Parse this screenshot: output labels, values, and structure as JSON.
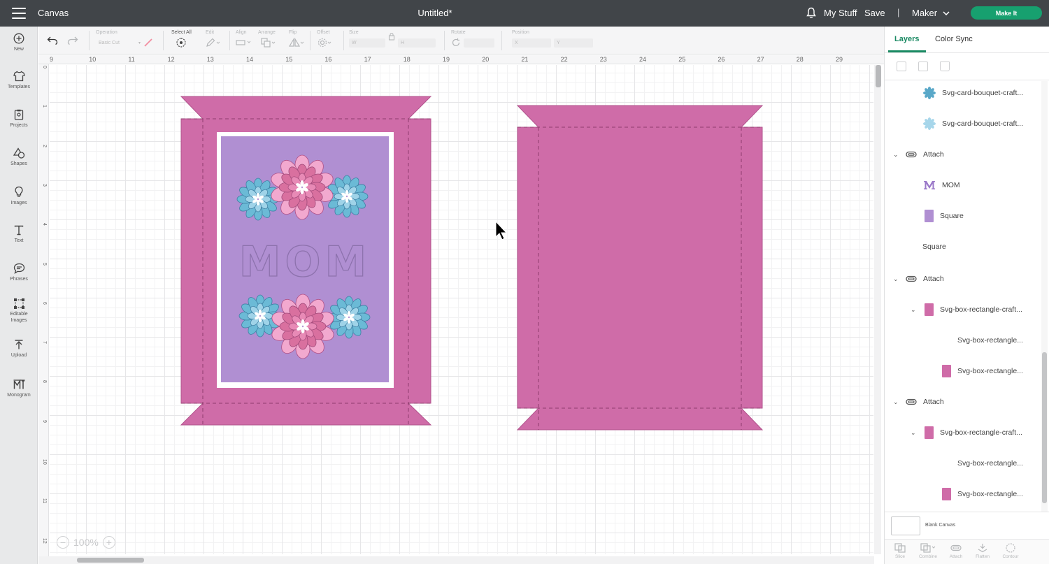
{
  "topbar": {
    "app_title": "Canvas",
    "doc_title": "Untitled*",
    "my_stuff": "My Stuff",
    "save": "Save",
    "separator": "|",
    "machine": "Maker",
    "make_it": "Make It"
  },
  "sidebar": [
    {
      "label": "New",
      "icon": "plus-circle-icon"
    },
    {
      "label": "Templates",
      "icon": "shirt-icon"
    },
    {
      "label": "Projects",
      "icon": "projects-icon"
    },
    {
      "label": "Shapes",
      "icon": "shapes-icon"
    },
    {
      "label": "Images",
      "icon": "lightbulb-icon"
    },
    {
      "label": "Text",
      "icon": "text-icon"
    },
    {
      "label": "Phrases",
      "icon": "speech-bubble-icon"
    },
    {
      "label": "Editable Images",
      "icon": "editable-images-icon"
    },
    {
      "label": "Upload",
      "icon": "upload-icon"
    },
    {
      "label": "Monogram",
      "icon": "monogram-icon"
    }
  ],
  "toolbar": {
    "operation_label": "Operation",
    "operation_value": "Basic Cut",
    "select_all": "Select All",
    "edit": "Edit",
    "align": "Align",
    "arrange": "Arrange",
    "flip": "Flip",
    "offset": "Offset",
    "size": "Size",
    "size_w": "W",
    "size_h": "H",
    "rotate": "Rotate",
    "position": "Position",
    "pos_x": "X",
    "pos_y": "Y"
  },
  "rulers": {
    "top": [
      "9",
      "10",
      "11",
      "12",
      "13",
      "14",
      "15",
      "16",
      "17",
      "18",
      "19",
      "20",
      "21",
      "22",
      "23",
      "24",
      "25",
      "26",
      "27",
      "28",
      "29"
    ],
    "left": [
      "0",
      "1",
      "2",
      "3",
      "4",
      "5",
      "6",
      "7",
      "8",
      "9",
      "10",
      "11",
      "12"
    ]
  },
  "canvas": {
    "card_text": "MOM",
    "zoom": "100%",
    "colors": {
      "box_pink": "#cf6ca8",
      "card_purple": "#b08fd2",
      "flower_blue": "#6bbad6",
      "flower_pink": "#d9709f",
      "flower_light_pink": "#f2a9cf"
    }
  },
  "panel": {
    "tab_layers": "Layers",
    "tab_color_sync": "Color Sync",
    "layers": [
      {
        "label": "Svg-card-bouquet-craft...",
        "thumb": "blue-flower-icon"
      },
      {
        "label": "Svg-card-bouquet-craft...",
        "thumb": "light-blue-flower-icon"
      },
      {
        "label": "Attach",
        "thumb": "attach-icon"
      },
      {
        "label": "MOM",
        "thumb": "letter-m-icon"
      },
      {
        "label": "Square",
        "thumb": "purple-swatch"
      },
      {
        "label": "Square",
        "thumb": "none"
      },
      {
        "label": "Attach",
        "thumb": "attach-icon"
      },
      {
        "label": "Svg-box-rectangle-craft...",
        "thumb": "pink-swatch"
      },
      {
        "label": "Svg-box-rectangle...",
        "thumb": "none"
      },
      {
        "label": "Svg-box-rectangle...",
        "thumb": "pink-swatch"
      },
      {
        "label": "Attach",
        "thumb": "attach-icon"
      },
      {
        "label": "Svg-box-rectangle-craft...",
        "thumb": "pink-swatch"
      },
      {
        "label": "Svg-box-rectangle...",
        "thumb": "none"
      },
      {
        "label": "Svg-box-rectangle...",
        "thumb": "pink-swatch"
      }
    ],
    "blank_canvas": "Blank Canvas",
    "bottom_tools": [
      "Slice",
      "Combine",
      "Attach",
      "Flatten",
      "Contour"
    ]
  }
}
